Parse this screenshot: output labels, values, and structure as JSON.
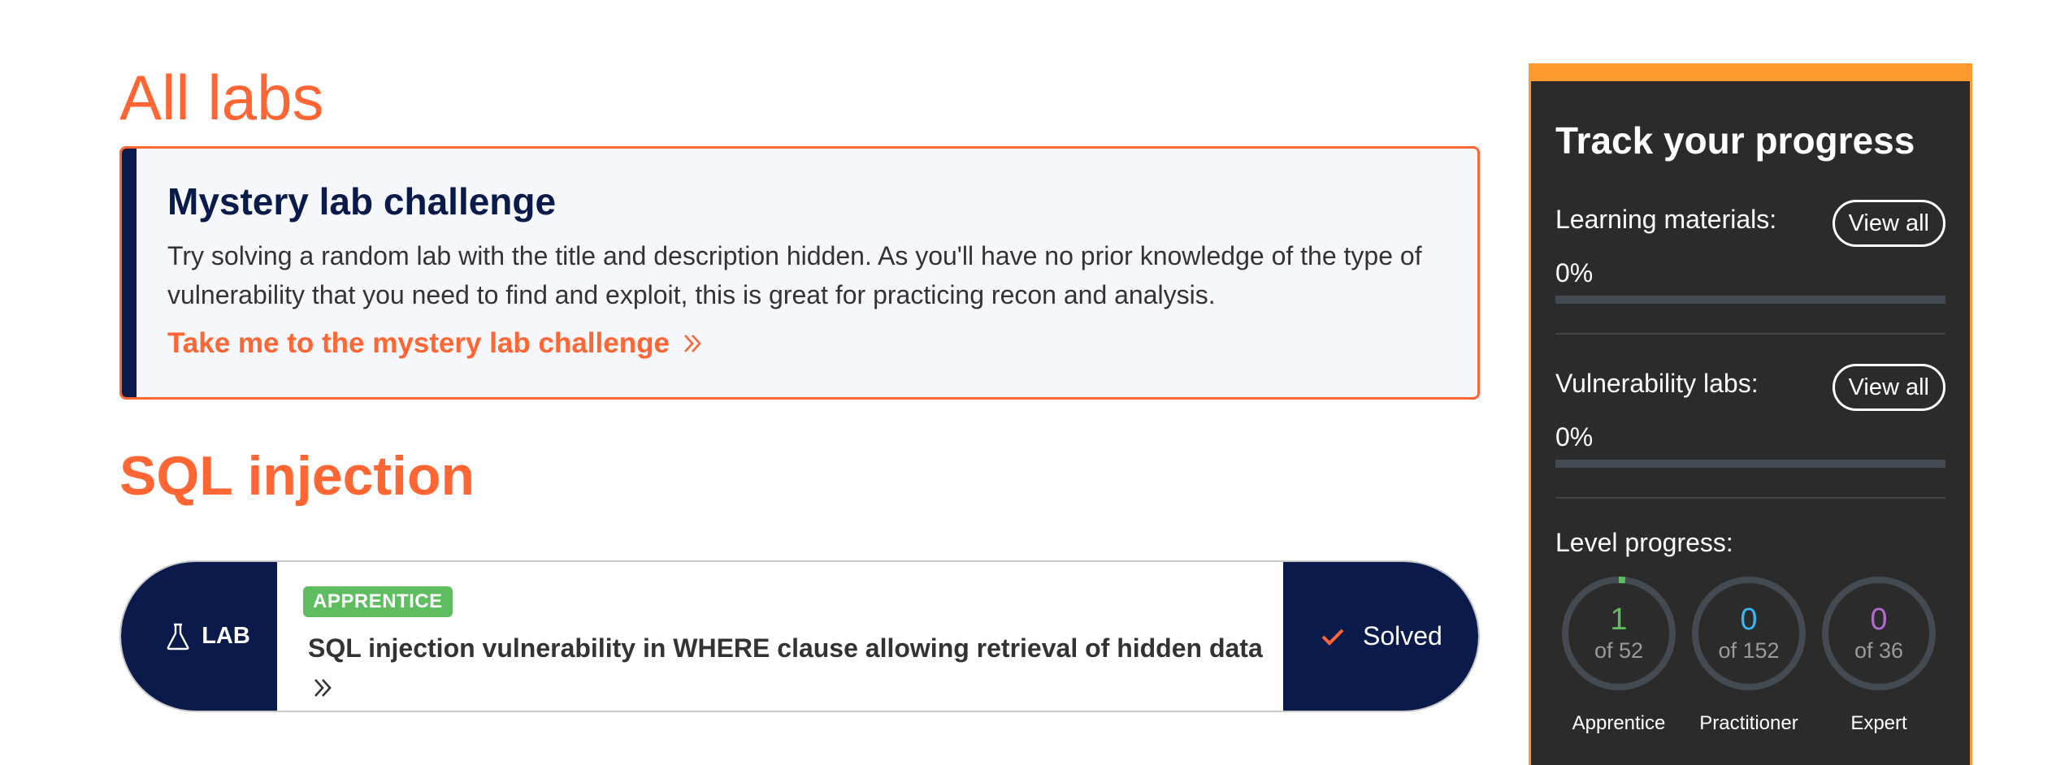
{
  "page": {
    "title": "All labs"
  },
  "mystery": {
    "title": "Mystery lab challenge",
    "description": "Try solving a random lab with the title and description hidden. As you'll have no prior knowledge of the type of vulnerability that you need to find and exploit, this is great for practicing recon and analysis.",
    "link_label": "Take me to the mystery lab challenge"
  },
  "section": {
    "title": "SQL injection"
  },
  "lab": {
    "tag_label": "LAB",
    "level": "APPRENTICE",
    "title": "SQL injection vulnerability in WHERE clause allowing retrieval of hidden data",
    "status": "Solved"
  },
  "progress": {
    "title": "Track your progress",
    "learning": {
      "label": "Learning materials:",
      "button": "View all",
      "percent": "0%",
      "fraction": 0
    },
    "vuln": {
      "label": "Vulnerability labs:",
      "button": "View all",
      "percent": "0%",
      "fraction": 0
    },
    "level_label": "Level progress:",
    "levels": [
      {
        "count": "1",
        "total": "of 52",
        "name": "Apprentice",
        "color": "#5ebd5e",
        "fraction": 0.019
      },
      {
        "count": "0",
        "total": "of 152",
        "name": "Practitioner",
        "color": "#3ab4f2",
        "fraction": 0
      },
      {
        "count": "0",
        "total": "of 36",
        "name": "Expert",
        "color": "#b36ad0",
        "fraction": 0
      }
    ]
  },
  "colors": {
    "accent": "#ff6633",
    "navy": "#0a1a4a",
    "orange": "#ff9a2e",
    "panel": "#2b2b2b"
  }
}
